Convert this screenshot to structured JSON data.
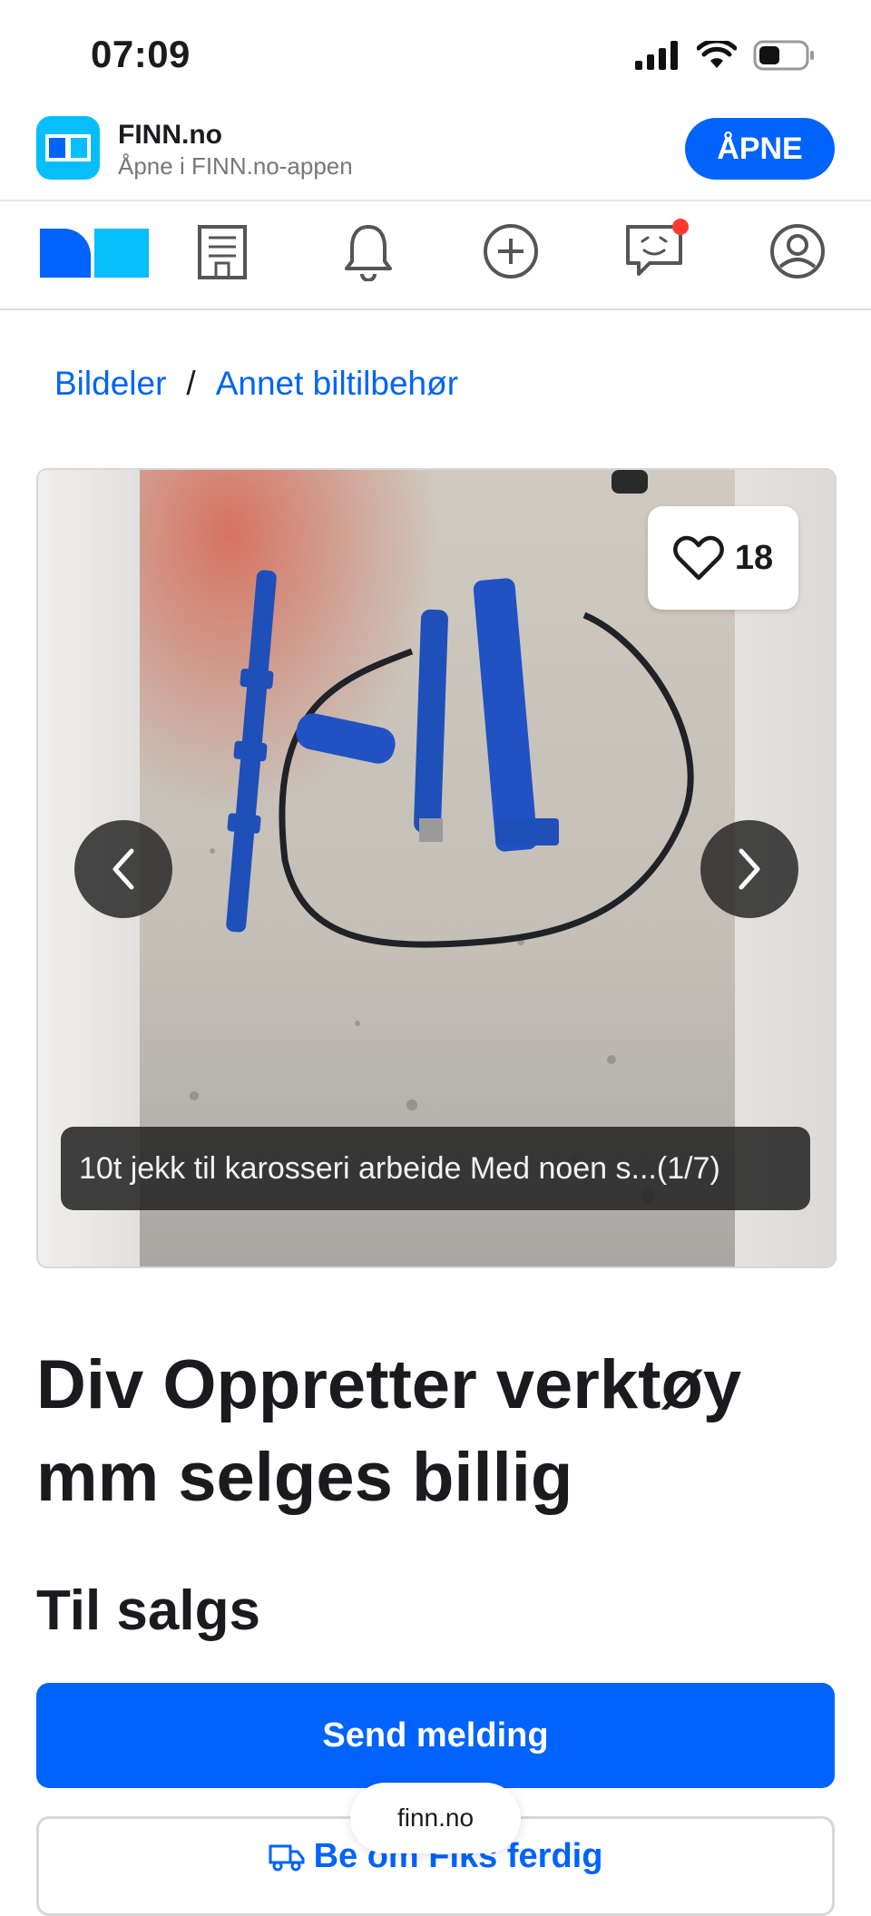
{
  "status_bar": {
    "time": "07:09"
  },
  "app_banner": {
    "title": "FINN.no",
    "subtitle": "Åpne i FINN.no-appen",
    "open_label": "ÅPNE"
  },
  "nav": {
    "icons": [
      "finn-logo-icon",
      "building-icon",
      "bell-icon",
      "plus-circle-icon",
      "chat-icon",
      "profile-icon"
    ],
    "notification_color": "#ff3b30"
  },
  "breadcrumb": {
    "items": [
      "Bildeler",
      "Annet biltilbehør"
    ],
    "separator": "/"
  },
  "gallery": {
    "favorite_count": "18",
    "caption": "10t jekk til karosseri arbeide Med noen s...",
    "counter": "(1/7)"
  },
  "ad": {
    "title": "Div Oppretter verktøy mm selges billig",
    "status": "Til salgs"
  },
  "actions": {
    "send_label": "Send melding",
    "fiks_label": "Be om Fiks ferdig"
  },
  "browser": {
    "url": "finn.no"
  },
  "colors": {
    "accent": "#0063fb",
    "brand_light": "#06befb",
    "brand_dark": "#0063fb",
    "text": "#1b1b1f"
  }
}
